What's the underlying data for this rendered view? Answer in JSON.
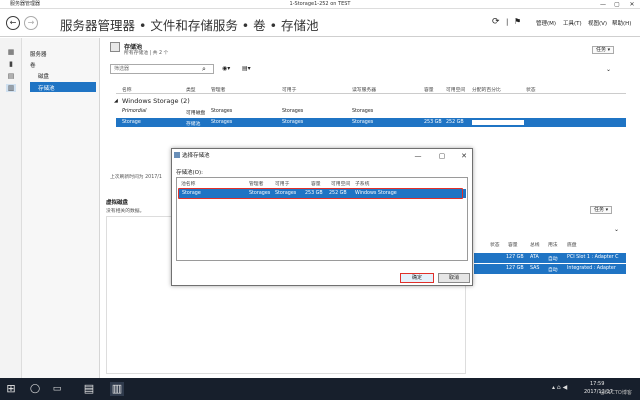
{
  "window": {
    "app_name": "服务器管理器",
    "vm_title": "1-Storage1-252 on TEST",
    "min": "—",
    "max": "▢",
    "close": "✕"
  },
  "nav": {
    "back": "←",
    "forward": "→",
    "breadcrumb": "服务器管理器 • 文件和存储服务 • 卷 • 存储池",
    "menu": [
      "管理(M)",
      "工具(T)",
      "视图(V)",
      "帮助(H)"
    ]
  },
  "left_nav": {
    "items": [
      "服务器",
      "卷",
      "磁盘",
      "存储池"
    ]
  },
  "pools": {
    "title": "存储池",
    "subtitle": "所有存储池 | 共 2 个",
    "tasks": "任务 ▾",
    "filter_placeholder": "筛选器",
    "columns": [
      "名称",
      "类型",
      "管理者",
      "可用于",
      "读写服务器",
      "容量",
      "可用空间",
      "分配的百分比",
      "状态"
    ],
    "group": "Windows Storage (2)",
    "rows": [
      {
        "name": "Primordial",
        "type": "可用磁盘",
        "managed": "Storages",
        "available": "Storages",
        "server": "Storages",
        "capacity": "",
        "free": ""
      },
      {
        "name": "Storage",
        "type": "存储池",
        "managed": "Storages",
        "available": "Storages",
        "server": "Storages",
        "capacity": "253 GB",
        "free": "252 GB"
      }
    ],
    "refresh_note": "上次刷新时间为 2017/1"
  },
  "disks": {
    "title": "虚拟磁盘",
    "empty": "没有相关的数据。",
    "tasks": "任务 ▾"
  },
  "physical": {
    "tasks": "任务 ▾",
    "columns": [
      "状态",
      "容量",
      "总线",
      "用法",
      "底盘"
    ],
    "rows": [
      {
        "capacity": "127 GB",
        "bus": "ATA",
        "usage": "自动",
        "chassis": "PCI Slot 1 : Adapter C"
      },
      {
        "capacity": "127 GB",
        "bus": "SAS",
        "usage": "自动",
        "chassis": "Integrated : Adapter"
      }
    ]
  },
  "dialog": {
    "title": "选择存储池",
    "label": "存储池(O):",
    "columns": [
      "池名称",
      "管理者",
      "可用于",
      "容量",
      "可用空间",
      "子系统"
    ],
    "row": {
      "name": "Storage",
      "managed": "Storages",
      "available": "Storages",
      "capacity": "253 GB",
      "free": "252 GB",
      "subsystem": "Windows Storage"
    },
    "ok": "确定",
    "cancel": "取消"
  },
  "taskbar": {
    "time": "17:59",
    "date": "2017/12/17",
    "watermark": "@51CTO博客"
  }
}
